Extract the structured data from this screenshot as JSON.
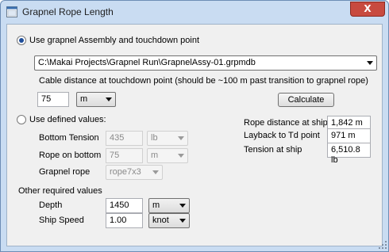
{
  "window": {
    "title": "Grapnel Rope Length",
    "close_label": "X"
  },
  "assembly_option": {
    "label": "Use grapnel Assembly and touchdown point",
    "selected": true,
    "file_path": "C:\\Makai Projects\\Grapnel Run\\GrapnelAssy-01.grpmdb",
    "cable_distance_label": "Cable distance at touchdown point (should be ~100 m past transition to grapnel rope)",
    "cable_distance_value": "75",
    "cable_distance_unit": "m",
    "calculate_label": "Calculate"
  },
  "defined_option": {
    "label": "Use defined values:",
    "selected": false,
    "bottom_tension_label": "Bottom Tension",
    "bottom_tension_value": "435",
    "bottom_tension_unit": "lb",
    "rope_on_bottom_label": "Rope on bottom",
    "rope_on_bottom_value": "75",
    "rope_on_bottom_unit": "m",
    "grapnel_rope_label": "Grapnel rope",
    "grapnel_rope_value": "rope7x3"
  },
  "results": {
    "rope_distance_label": "Rope distance at ship",
    "rope_distance_value": "1,842 m",
    "layback_label": "Layback to Td point",
    "layback_value": "971 m",
    "tension_label": "Tension at ship",
    "tension_value": "6,510.8 lb"
  },
  "other": {
    "heading": "Other required values",
    "depth_label": "Depth",
    "depth_value": "1450",
    "depth_unit": "m",
    "ship_speed_label": "Ship Speed",
    "ship_speed_value": "1.00",
    "ship_speed_unit": "knot"
  }
}
